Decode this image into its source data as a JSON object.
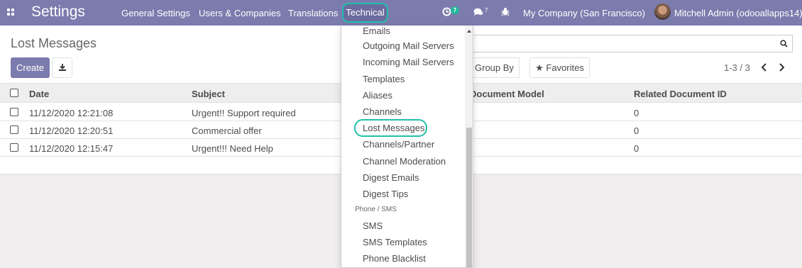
{
  "navbar": {
    "brand": "Settings",
    "menus": [
      "General Settings",
      "Users & Companies",
      "Translations"
    ],
    "active_menu": "Technical",
    "activity_count": "7",
    "messages_count": "7",
    "company": "My Company (San Francisco)",
    "user": "Mitchell Admin (odooallapps14)",
    "accent_color": "#7c7bad",
    "highlight_color": "#1ec0ab"
  },
  "control_panel": {
    "breadcrumb": "Lost Messages",
    "create_label": "Create",
    "group_by_label": "Group By",
    "favorites_label": "Favorites",
    "pager": "1-3 / 3"
  },
  "list": {
    "columns": [
      "Date",
      "Subject",
      "Document Model",
      "Related Document ID"
    ],
    "rows": [
      {
        "date": "11/12/2020 12:21:08",
        "subject": "Urgent!! Support required",
        "related_id": "0"
      },
      {
        "date": "11/12/2020 12:20:51",
        "subject": "Commercial offer",
        "related_id": "0"
      },
      {
        "date": "11/12/2020 12:15:47",
        "subject": "Urgent!!! Need Help",
        "related_id": "0"
      }
    ]
  },
  "dropdown": {
    "items": [
      "Emails",
      "Outgoing Mail Servers",
      "Incoming Mail Servers",
      "Templates",
      "Aliases",
      "Channels",
      "Lost Messages",
      "Channels/Partner",
      "Channel Moderation",
      "Digest Emails",
      "Digest Tips"
    ],
    "section_header": "Phone / SMS",
    "section_items": [
      "SMS",
      "SMS Templates",
      "Phone Blacklist"
    ],
    "selected": "Lost Messages"
  }
}
